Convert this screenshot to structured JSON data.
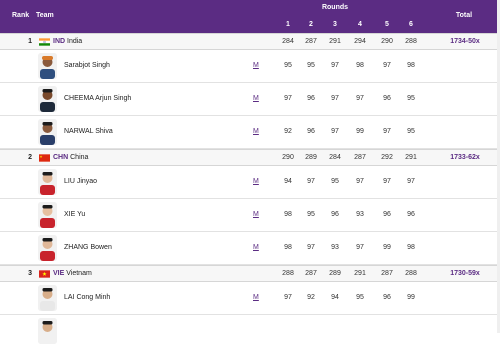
{
  "header": {
    "rank": "Rank",
    "team": "Team",
    "rounds": "Rounds",
    "total": "Total",
    "round_numbers": [
      "1",
      "2",
      "3",
      "4",
      "5",
      "6"
    ]
  },
  "teams": [
    {
      "rank": "1",
      "code": "IND",
      "country": "India",
      "flag": "india-flag",
      "rounds": [
        "284",
        "287",
        "291",
        "294",
        "290",
        "288"
      ],
      "total": "1734-50x",
      "athletes": [
        {
          "name": "Sarabjot Singh",
          "m": "M",
          "rounds": [
            "95",
            "95",
            "97",
            "98",
            "97",
            "98"
          ]
        },
        {
          "name": "CHEEMA Arjun Singh",
          "m": "M",
          "rounds": [
            "97",
            "96",
            "97",
            "97",
            "96",
            "95"
          ]
        },
        {
          "name": "NARWAL Shiva",
          "m": "M",
          "rounds": [
            "92",
            "96",
            "97",
            "99",
            "97",
            "95"
          ]
        }
      ]
    },
    {
      "rank": "2",
      "code": "CHN",
      "country": "China",
      "flag": "china-flag",
      "rounds": [
        "290",
        "289",
        "284",
        "287",
        "292",
        "291"
      ],
      "total": "1733-62x",
      "athletes": [
        {
          "name": "LIU Jinyao",
          "m": "M",
          "rounds": [
            "94",
            "97",
            "95",
            "97",
            "97",
            "97"
          ]
        },
        {
          "name": "XIE Yu",
          "m": "M",
          "rounds": [
            "98",
            "95",
            "96",
            "93",
            "96",
            "96"
          ]
        },
        {
          "name": "ZHANG Bowen",
          "m": "M",
          "rounds": [
            "98",
            "97",
            "93",
            "97",
            "99",
            "98"
          ]
        }
      ]
    },
    {
      "rank": "3",
      "code": "VIE",
      "country": "Vietnam",
      "flag": "vietnam-flag",
      "rounds": [
        "288",
        "287",
        "289",
        "291",
        "287",
        "288"
      ],
      "total": "1730-59x",
      "athletes": [
        {
          "name": "LAI Cong Minh",
          "m": "M",
          "rounds": [
            "97",
            "92",
            "94",
            "95",
            "96",
            "99"
          ]
        }
      ]
    }
  ],
  "colors": {
    "header_bg": "#5b2c83",
    "accent": "#5b2c83",
    "row_border": "#e2e2e2"
  }
}
